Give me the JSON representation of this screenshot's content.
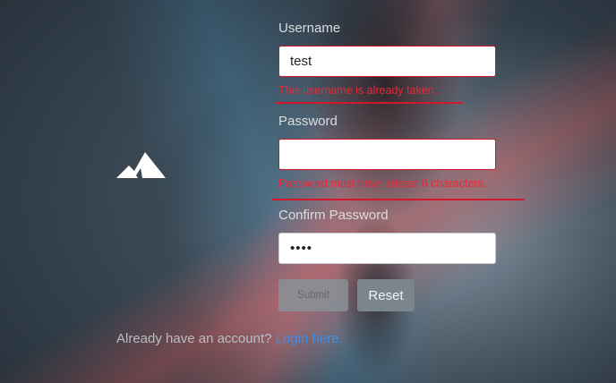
{
  "form": {
    "username": {
      "label": "Username",
      "value": "test",
      "error": "This username is already taken."
    },
    "password": {
      "label": "Password",
      "value": "",
      "error": "Password must have atleast 6 characters."
    },
    "confirm_password": {
      "label": "Confirm Password",
      "value": "••••"
    },
    "submit_label": "Submit",
    "reset_label": "Reset"
  },
  "footer": {
    "prompt": "Already have an account?",
    "link_text": "Login here."
  },
  "colors": {
    "error": "#e8283a",
    "link": "#3d8fe8"
  }
}
